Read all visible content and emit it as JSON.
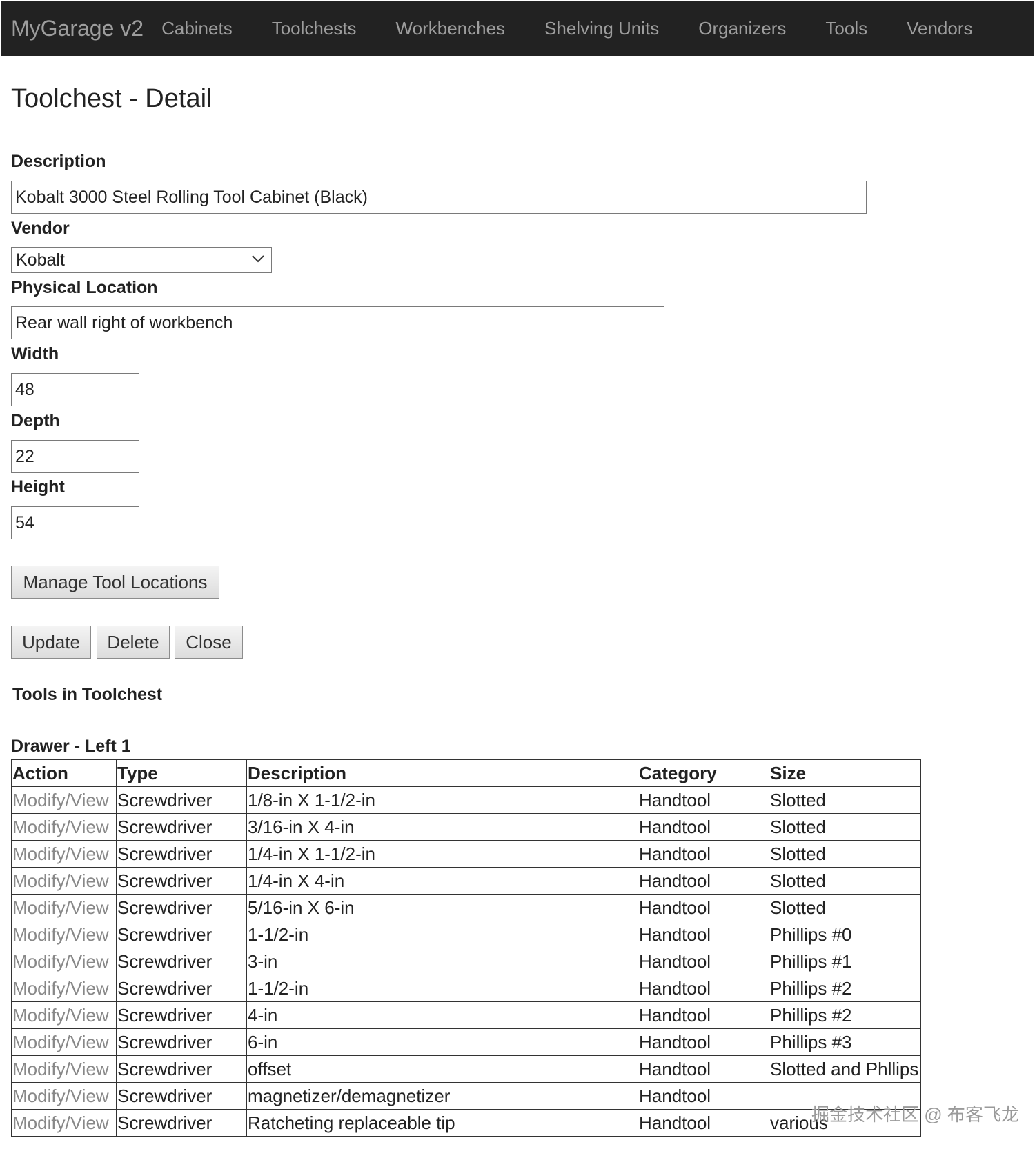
{
  "nav": {
    "brand": "MyGarage v2",
    "links": [
      "Cabinets",
      "Toolchests",
      "Workbenches",
      "Shelving Units",
      "Organizers",
      "Tools",
      "Vendors"
    ]
  },
  "page": {
    "title": "Toolchest - Detail"
  },
  "form": {
    "description": {
      "label": "Description",
      "value": "Kobalt 3000 Steel Rolling Tool Cabinet (Black)"
    },
    "vendor": {
      "label": "Vendor",
      "value": "Kobalt"
    },
    "location": {
      "label": "Physical Location",
      "value": "Rear wall right of workbench"
    },
    "width": {
      "label": "Width",
      "value": "48"
    },
    "depth": {
      "label": "Depth",
      "value": "22"
    },
    "height": {
      "label": "Height",
      "value": "54"
    }
  },
  "buttons": {
    "manage": "Manage Tool Locations",
    "update": "Update",
    "delete": "Delete",
    "close": "Close"
  },
  "tools_section": {
    "title": "Tools in Toolchest",
    "drawer": "Drawer - Left 1",
    "columns": [
      "Action",
      "Type",
      "Description",
      "Category",
      "Size"
    ],
    "rows": [
      {
        "action": "Modify/View",
        "type": "Screwdriver",
        "description": "1/8-in X 1-1/2-in",
        "category": "Handtool",
        "size": "Slotted"
      },
      {
        "action": "Modify/View",
        "type": "Screwdriver",
        "description": "3/16-in X 4-in",
        "category": "Handtool",
        "size": "Slotted"
      },
      {
        "action": "Modify/View",
        "type": "Screwdriver",
        "description": "1/4-in X 1-1/2-in",
        "category": "Handtool",
        "size": "Slotted"
      },
      {
        "action": "Modify/View",
        "type": "Screwdriver",
        "description": "1/4-in X 4-in",
        "category": "Handtool",
        "size": "Slotted"
      },
      {
        "action": "Modify/View",
        "type": "Screwdriver",
        "description": "5/16-in X 6-in",
        "category": "Handtool",
        "size": "Slotted"
      },
      {
        "action": "Modify/View",
        "type": "Screwdriver",
        "description": "1-1/2-in",
        "category": "Handtool",
        "size": "Phillips #0"
      },
      {
        "action": "Modify/View",
        "type": "Screwdriver",
        "description": "3-in",
        "category": "Handtool",
        "size": "Phillips #1"
      },
      {
        "action": "Modify/View",
        "type": "Screwdriver",
        "description": "1-1/2-in",
        "category": "Handtool",
        "size": "Phillips #2"
      },
      {
        "action": "Modify/View",
        "type": "Screwdriver",
        "description": "4-in",
        "category": "Handtool",
        "size": "Phillips #2"
      },
      {
        "action": "Modify/View",
        "type": "Screwdriver",
        "description": "6-in",
        "category": "Handtool",
        "size": "Phillips #3"
      },
      {
        "action": "Modify/View",
        "type": "Screwdriver",
        "description": "offset",
        "category": "Handtool",
        "size": "Slotted and Phllips"
      },
      {
        "action": "Modify/View",
        "type": "Screwdriver",
        "description": "magnetizer/demagnetizer",
        "category": "Handtool",
        "size": ""
      },
      {
        "action": "Modify/View",
        "type": "Screwdriver",
        "description": "Ratcheting replaceable tip",
        "category": "Handtool",
        "size": "various"
      }
    ]
  },
  "watermark": "掘金技术社区 @ 布客飞龙",
  "colors": {
    "navbar": "#222222",
    "nav_text": "#9d9d9d",
    "link": "#888888",
    "border": "#333333"
  }
}
